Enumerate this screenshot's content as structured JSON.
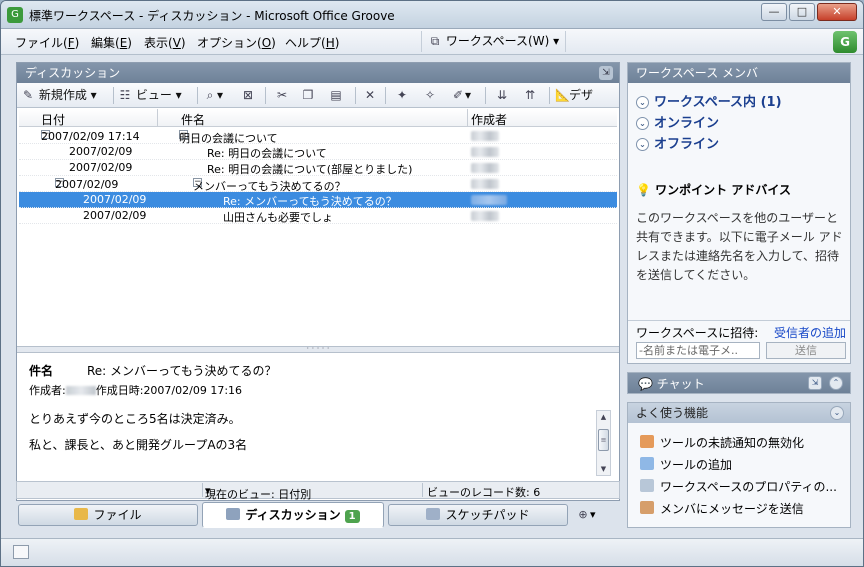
{
  "window": {
    "title": "標準ワークスペース - ディスカッション - Microsoft Office Groove",
    "minimize": "—",
    "maximize": "□",
    "close": "✕"
  },
  "menubar": {
    "items": [
      {
        "label": "ファイル(",
        "key": "F",
        "tail": ")"
      },
      {
        "label": "編集(",
        "key": "E",
        "tail": ")"
      },
      {
        "label": "表示(",
        "key": "V",
        "tail": ")"
      },
      {
        "label": "オプション(",
        "key": "O",
        "tail": ")"
      },
      {
        "label": "ヘルプ(",
        "key": "H",
        "tail": ")"
      }
    ],
    "workspace_menu": "ワークスペース(W)"
  },
  "discussion": {
    "panel_title": "ディスカッション",
    "toolbar": {
      "new": "新規作成",
      "view": "ビュー",
      "reply_label": "デザ"
    },
    "columns": {
      "date": "日付",
      "subject": "件名",
      "author": "作成者"
    },
    "rows": [
      {
        "date": "2007/02/09 17:14",
        "subject": "明日の会議について"
      },
      {
        "date": "2007/02/09",
        "subject": "Re: 明日の会議について"
      },
      {
        "date": "2007/02/09",
        "subject": "Re: 明日の会議について(部屋とりました)"
      },
      {
        "date": "2007/02/09",
        "subject": "メンバーってもう決めてるの？"
      },
      {
        "date": "2007/02/09",
        "subject": "Re: メンバーってもう決めてるの？"
      },
      {
        "date": "2007/02/09",
        "subject": "山田さんも必要でしょ"
      }
    ],
    "preview": {
      "subject_label": "件名",
      "subject": "Re: メンバーってもう決めてるの？",
      "author_label": "作成者:",
      "created_label": "作成日時:",
      "created": "2007/02/09 17:16",
      "body_line1": "とりあえず今のところ5名は決定済み。",
      "body_line2": "私と、課長と、あと開発グループAの3名"
    },
    "status": {
      "current_view": "現在のビュー: 日付別",
      "record_count": "ビューのレコード数: 6"
    }
  },
  "tabs": [
    {
      "label": "ファイル"
    },
    {
      "label": "ディスカッション",
      "badge": "1"
    },
    {
      "label": "スケッチパッド"
    }
  ],
  "members": {
    "title": "ワークスペース メンバ",
    "groups": [
      {
        "label": "ワークスペース内 (1)"
      },
      {
        "label": "オンライン"
      },
      {
        "label": "オフライン"
      }
    ],
    "tip_title": "ワンポイント アドバイス",
    "tip_body": "このワークスペースを他のユーザーと共有できます。以下に電子メール アドレスまたは連絡先名を入力して、招待を送信してください。",
    "invite_label": "ワークスペースに招待:",
    "add_recipient": "受信者の追加",
    "invite_placeholder": "-名前または電子メ..",
    "send": "送信"
  },
  "chat": {
    "title": "チャット"
  },
  "favorites": {
    "title": "よく使う機能",
    "items": [
      {
        "label": "ツールの未読通知の無効化"
      },
      {
        "label": "ツールの追加"
      },
      {
        "label": "ワークスペースのプロパティの..."
      },
      {
        "label": "メンバにメッセージを送信"
      }
    ]
  },
  "colors": {
    "panel_header": "#7a8ca2",
    "selection": "#3c8ce0",
    "link": "#1546c7",
    "member_group": "#1b3f8f"
  }
}
